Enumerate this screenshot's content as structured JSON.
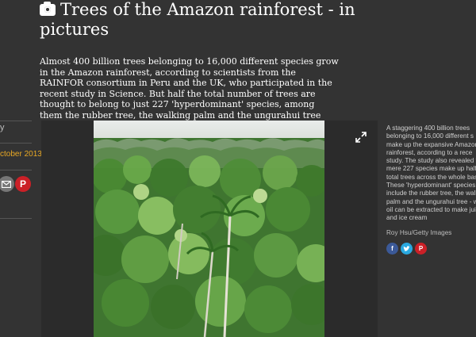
{
  "article": {
    "title": "Trees of the Amazon rainforest - in pictures",
    "standfirst": "Almost 400 billion trees belonging to 16,000 different species grow in the Amazon rainforest, according to scientists from the RAINFOR consortium in Peru and the UK, who participated in the recent study in Science. But half the total number of trees are thought to belong to just 227 'hyperdominant' species, among them the rubber tree, the walking palm and the ungurahui tree"
  },
  "left_meta": {
    "byline_fragment": "y",
    "date_fragment": "ctober 2013"
  },
  "caption": {
    "lines": [
      "A staggering 400 billion trees",
      "belonging to 16,000 different s",
      "make up the expansive Amazon",
      "rainforest, according to a rece",
      "study. The study also revealed th",
      "mere 227 species make up half o",
      "total trees across the whole bas",
      "These 'hyperdominant' species",
      "include the rubber tree, the walk",
      "palm and the ungurahui tree - w",
      "oil can be extracted to make juic",
      "and ice cream"
    ],
    "credit": "Roy Hsu/Getty Images"
  },
  "colors": {
    "background": "#333333",
    "date_accent": "#e8a824",
    "facebook": "#3b5998",
    "twitter": "#2aa9e0",
    "pinterest": "#cb2027",
    "email": "#767676"
  },
  "icons": [
    "camera-icon",
    "expand-icon",
    "email-icon",
    "pinterest-icon",
    "facebook-icon",
    "twitter-icon"
  ]
}
